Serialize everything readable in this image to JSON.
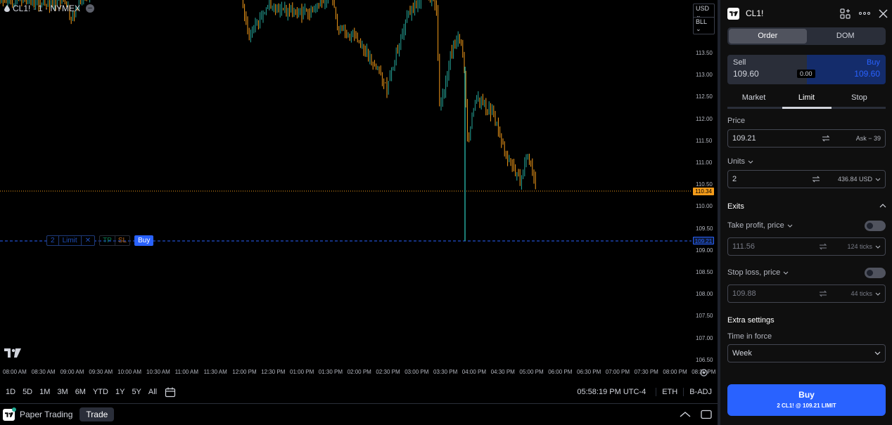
{
  "chart": {
    "legend": "CL1! · 1 · NYMEX",
    "currency": "USD",
    "unit": "BLL",
    "price_axis": [
      "113.50",
      "113.00",
      "112.50",
      "112.00",
      "111.50",
      "111.00",
      "110.50",
      "110.00",
      "109.50",
      "109.00",
      "108.50",
      "108.00",
      "107.50",
      "107.00",
      "106.50"
    ],
    "time_axis": [
      "08:00 AM",
      "08:30 AM",
      "09:00 AM",
      "09:30 AM",
      "10:00 AM",
      "10:30 AM",
      "11:00 AM",
      "11:30 AM",
      "12:00 PM",
      "12:30 PM",
      "01:00 PM",
      "01:30 PM",
      "02:00 PM",
      "02:30 PM",
      "03:00 PM",
      "03:30 PM",
      "04:00 PM",
      "04:30 PM",
      "05:00 PM",
      "06:00 PM",
      "06:30 PM",
      "07:00 PM",
      "07:30 PM",
      "08:00 PM",
      "08:30 PM"
    ],
    "last_price": "110.34",
    "order_price": "109.21",
    "order_line": {
      "qty": "2",
      "type": "Limit",
      "close": "✕",
      "tp": "TP",
      "sl": "SL",
      "side": "Buy"
    },
    "colors": {
      "up": "#26a69a",
      "down": "#f59c1a",
      "accent": "#2962ff"
    }
  },
  "range_bar": {
    "ranges": [
      "1D",
      "5D",
      "1M",
      "3M",
      "6M",
      "YTD",
      "1Y",
      "5Y",
      "All"
    ],
    "clock": "05:58:19 PM UTC-4",
    "session": "ETH",
    "adjust": "B-ADJ"
  },
  "bottom_bar": {
    "paper_label": "Paper Trading",
    "trade_tab": "Trade"
  },
  "panel": {
    "symbol": "CL1!",
    "tabs": [
      "Order",
      "DOM"
    ],
    "sell_label": "Sell",
    "sell_price": "109.60",
    "buy_label": "Buy",
    "buy_price": "109.60",
    "spread": "0.00",
    "order_types": [
      "Market",
      "Limit",
      "Stop"
    ],
    "price_label": "Price",
    "price_value": "109.21",
    "price_right": "Ask − 39",
    "units_label": "Units",
    "units_value": "2",
    "units_right": "436.84 USD",
    "exits_label": "Exits",
    "tp_label": "Take profit, price",
    "tp_value": "111.56",
    "tp_right": "124 ticks",
    "sl_label": "Stop loss, price",
    "sl_value": "109.88",
    "sl_right": "44 ticks",
    "extra_label": "Extra settings",
    "tif_label": "Time in force",
    "tif_value": "Week",
    "submit_title": "Buy",
    "submit_sub": "2 CL1! @ 109.21 LIMIT"
  }
}
